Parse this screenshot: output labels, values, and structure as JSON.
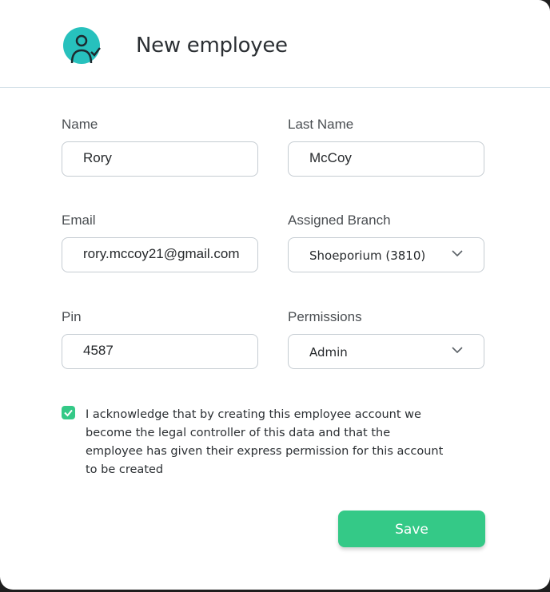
{
  "header": {
    "title": "New employee",
    "icon": "employee-add-icon"
  },
  "colors": {
    "accent": "#34c987",
    "icon_teal": "#27c1bd",
    "border": "#c5ccd2"
  },
  "form": {
    "name": {
      "label": "Name",
      "value": "Rory"
    },
    "last_name": {
      "label": "Last Name",
      "value": "McCoy"
    },
    "email": {
      "label": "Email",
      "value": "rory.mccoy21@gmail.com"
    },
    "branch": {
      "label": "Assigned Branch",
      "value": "Shoeporium (3810)"
    },
    "pin": {
      "label": "Pin",
      "value": "4587"
    },
    "permissions": {
      "label": "Permissions",
      "value": "Admin"
    }
  },
  "consent": {
    "checked": true,
    "text": "I acknowledge that by creating this employee account we become the legal controller of this data and that the employee has given their express permission for this account to be created"
  },
  "actions": {
    "save_label": "Save"
  }
}
